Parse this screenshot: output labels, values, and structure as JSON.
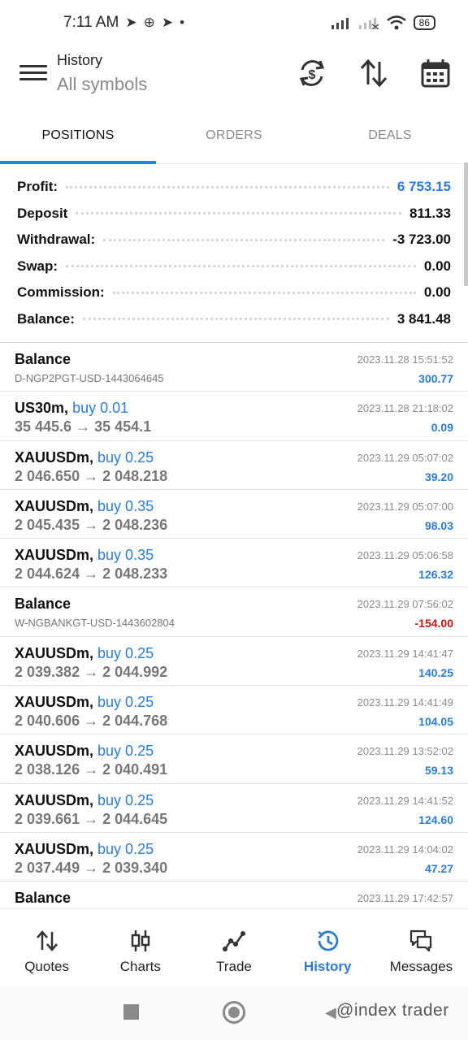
{
  "status_bar": {
    "time": "7:11 AM",
    "battery": "86"
  },
  "header": {
    "title": "History",
    "subtitle": "All symbols"
  },
  "tabs": [
    {
      "label": "POSITIONS",
      "active": true
    },
    {
      "label": "ORDERS",
      "active": false
    },
    {
      "label": "DEALS",
      "active": false
    }
  ],
  "summary": {
    "profit_label": "Profit:",
    "profit_value": "6 753.15",
    "deposit_label": "Deposit",
    "deposit_value": "811.33",
    "withdrawal_label": "Withdrawal:",
    "withdrawal_value": "-3 723.00",
    "swap_label": "Swap:",
    "swap_value": "0.00",
    "commission_label": "Commission:",
    "commission_value": "0.00",
    "balance_label": "Balance:",
    "balance_value": "3 841.48"
  },
  "rows": [
    {
      "symbol": "Balance",
      "action": "",
      "sub": "D-NGP2PGT-USD-1443064645",
      "date": "2023.11.28 15:51:52",
      "profit": "300.77"
    },
    {
      "symbol": "US30m,",
      "action": "buy 0.01",
      "sub": "35 445.6 → 35 454.1",
      "date": "2023.11.28 21:18:02",
      "profit": "0.09"
    },
    {
      "symbol": "XAUUSDm,",
      "action": "buy 0.25",
      "sub": "2 046.650 → 2 048.218",
      "date": "2023.11.29 05:07:02",
      "profit": "39.20"
    },
    {
      "symbol": "XAUUSDm,",
      "action": "buy 0.35",
      "sub": "2 045.435 → 2 048.236",
      "date": "2023.11.29 05:07:00",
      "profit": "98.03"
    },
    {
      "symbol": "XAUUSDm,",
      "action": "buy 0.35",
      "sub": "2 044.624 → 2 048.233",
      "date": "2023.11.29 05:06:58",
      "profit": "126.32"
    },
    {
      "symbol": "Balance",
      "action": "",
      "sub": "W-NGBANKGT-USD-1443602804",
      "date": "2023.11.29 07:56:02",
      "profit": "-154.00"
    },
    {
      "symbol": "XAUUSDm,",
      "action": "buy 0.25",
      "sub": "2 039.382 → 2 044.992",
      "date": "2023.11.29 14:41:47",
      "profit": "140.25"
    },
    {
      "symbol": "XAUUSDm,",
      "action": "buy 0.25",
      "sub": "2 040.606 → 2 044.768",
      "date": "2023.11.29 14:41:49",
      "profit": "104.05"
    },
    {
      "symbol": "XAUUSDm,",
      "action": "buy 0.25",
      "sub": "2 038.126 → 2 040.491",
      "date": "2023.11.29 13:52:02",
      "profit": "59.13"
    },
    {
      "symbol": "XAUUSDm,",
      "action": "buy 0.25",
      "sub": "2 039.661 → 2 044.645",
      "date": "2023.11.29 14:41:52",
      "profit": "124.60"
    },
    {
      "symbol": "XAUUSDm,",
      "action": "buy 0.25",
      "sub": "2 037.449 → 2 039.340",
      "date": "2023.11.29 14:04:02",
      "profit": "47.27"
    },
    {
      "symbol": "Balance",
      "action": "",
      "sub": "",
      "date": "2023.11.29 17:42:57",
      "profit": ""
    }
  ],
  "bottom_nav": [
    {
      "label": "Quotes",
      "icon": "quotes-icon",
      "active": false
    },
    {
      "label": "Charts",
      "icon": "charts-icon",
      "active": false
    },
    {
      "label": "Trade",
      "icon": "trade-icon",
      "active": false
    },
    {
      "label": "History",
      "icon": "history-icon",
      "active": true
    },
    {
      "label": "Messages",
      "icon": "messages-icon",
      "active": false
    }
  ],
  "watermark": "@index trader",
  "colors": {
    "accent": "#2b7bd8",
    "negative": "#c0141b",
    "muted": "#8a8a8a"
  }
}
